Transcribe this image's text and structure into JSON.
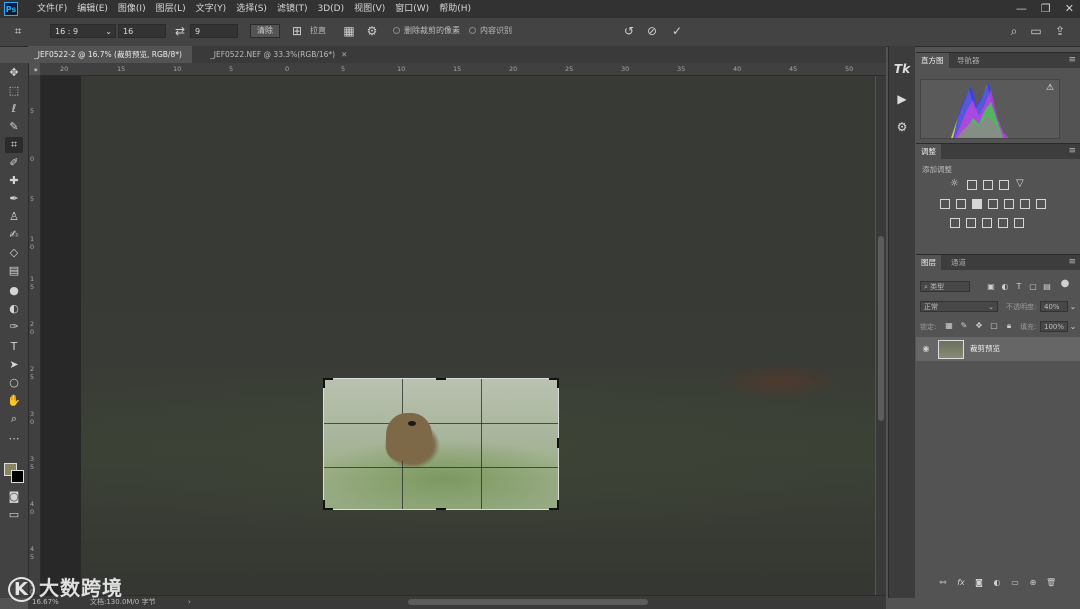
{
  "menubar": {
    "app_logo": "Ps",
    "items": [
      "文件(F)",
      "编辑(E)",
      "图像(I)",
      "图层(L)",
      "文字(Y)",
      "选择(S)",
      "滤镜(T)",
      "3D(D)",
      "视图(V)",
      "窗口(W)",
      "帮助(H)"
    ],
    "window_controls": [
      "—",
      "❐",
      "✕"
    ]
  },
  "options": {
    "ratio_value": "16 : 9",
    "width_value": "16",
    "height_value": "9",
    "clear_label": "清除",
    "straighten_label": "拉直",
    "delete_cropped_label": "删除裁剪的像素",
    "content_aware_label": "内容识别"
  },
  "tabs": [
    {
      "label": "_JEF0522-2 @ 16.7% (裁剪预览, RGB/8*) *",
      "close": "✕"
    },
    {
      "label": "_JEF0522.NEF @ 33.3%(RGB/16*)",
      "close": "✕"
    }
  ],
  "ruler": {
    "h_ticks": [
      "20",
      "15",
      "10",
      "5",
      "0",
      "5",
      "10",
      "15",
      "20",
      "25",
      "30",
      "35",
      "40",
      "45",
      "50"
    ],
    "v_ticks": [
      "5",
      "0",
      "5",
      "1 0",
      "1 5",
      "2 0",
      "2 5",
      "3 0",
      "3 5",
      "4 0",
      "4 5",
      "5 0"
    ]
  },
  "panels": {
    "histogram_tab": "直方图",
    "navigator_tab": "导航器",
    "warning_icon": "⚠",
    "adjustments_tab": "调整",
    "add_adjustment_label": "添加调整",
    "layers_tab": "图层",
    "channels_tab": "通道",
    "search_placeholder": "类型",
    "blend_mode": "正常",
    "opacity_label": "不透明度:",
    "opacity_value": "40%",
    "lock_label": "锁定:",
    "fill_label": "填充:",
    "fill_value": "100%",
    "layer_name": "裁剪预览",
    "panel_menu_icon": "≡"
  },
  "statusbar": {
    "zoom": "16.67%",
    "doc_info": "文档:130.0M/0 字节",
    "arrow": "›"
  },
  "watermark": "大数跨境",
  "watermark_logo": "K"
}
